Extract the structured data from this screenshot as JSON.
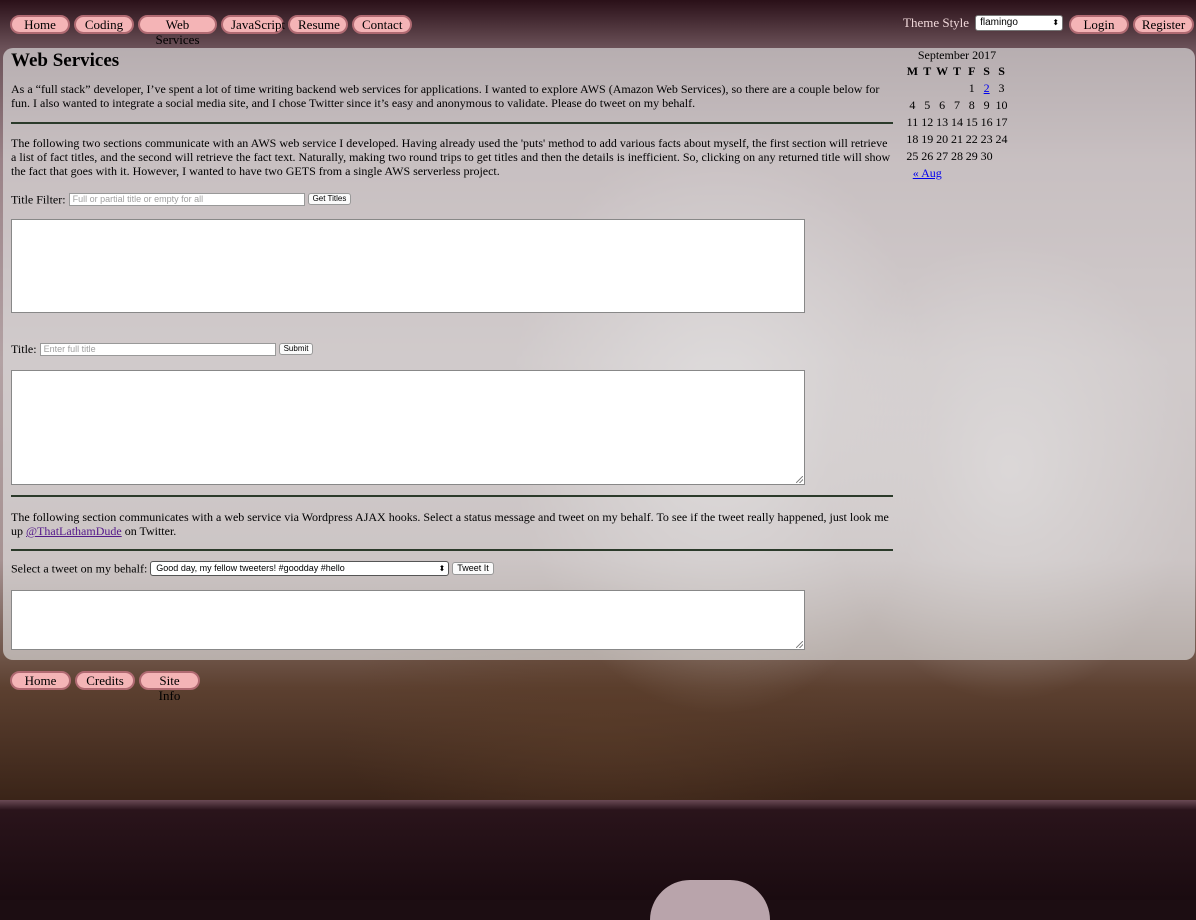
{
  "nav": {
    "items": [
      "Home",
      "Coding",
      "Web Services",
      "JavaScript",
      "Resume",
      "Contact"
    ]
  },
  "theme": {
    "label": "Theme Style",
    "selected": "flamingo"
  },
  "auth": {
    "login": "Login",
    "register": "Register"
  },
  "page": {
    "title": "Web Services",
    "intro": "As a “full stack” developer, I’ve spent a lot of time writing backend web services for applications. I wanted to explore AWS (Amazon Web Services), so there are a couple below for fun. I also wanted to integrate a social media site, and I chose Twitter since it’s easy and anonymous to validate. Please do tweet on my behalf.",
    "aws_text": "The following two sections communicate with an AWS web service I developed. Having already used the 'puts' method to add various facts about myself, the first section will retrieve a list of fact titles, and the second will retrieve the fact text. Naturally, making two round trips to get titles and then the details is inefficient. So, clicking on any returned title will show the fact that goes with it. However, I wanted to have two GETS from a single AWS serverless project.",
    "title_filter": {
      "label": "Title Filter:",
      "placeholder": "Full or partial title or empty for all",
      "button": "Get Titles"
    },
    "title_lookup": {
      "label": "Title:",
      "placeholder": "Enter full title",
      "button": "Submit"
    },
    "ajax_text_before": "The following section communicates with a web service via Wordpress AJAX hooks. Select a status message and tweet on my behalf. To see if the tweet really happened, just look me up",
    "twitter_handle": "@ThatLathamDude",
    "ajax_text_after": "on Twitter.",
    "tweet": {
      "label": "Select a tweet on my behalf:",
      "selected": "Good day, my fellow tweeters! #goodday #hello",
      "button": "Tweet It"
    }
  },
  "calendar": {
    "caption": "September 2017",
    "weekdays": [
      "M",
      "T",
      "W",
      "T",
      "F",
      "S",
      "S"
    ],
    "weeks": [
      [
        "",
        "",
        "",
        "",
        "1",
        "2",
        "3"
      ],
      [
        "4",
        "5",
        "6",
        "7",
        "8",
        "9",
        "10"
      ],
      [
        "11",
        "12",
        "13",
        "14",
        "15",
        "16",
        "17"
      ],
      [
        "18",
        "19",
        "20",
        "21",
        "22",
        "23",
        "24"
      ],
      [
        "25",
        "26",
        "27",
        "28",
        "29",
        "30",
        ""
      ]
    ],
    "linked_day": "2",
    "prev": "« Aug"
  },
  "footer": {
    "items": [
      "Home",
      "Credits",
      "Site Info"
    ]
  }
}
